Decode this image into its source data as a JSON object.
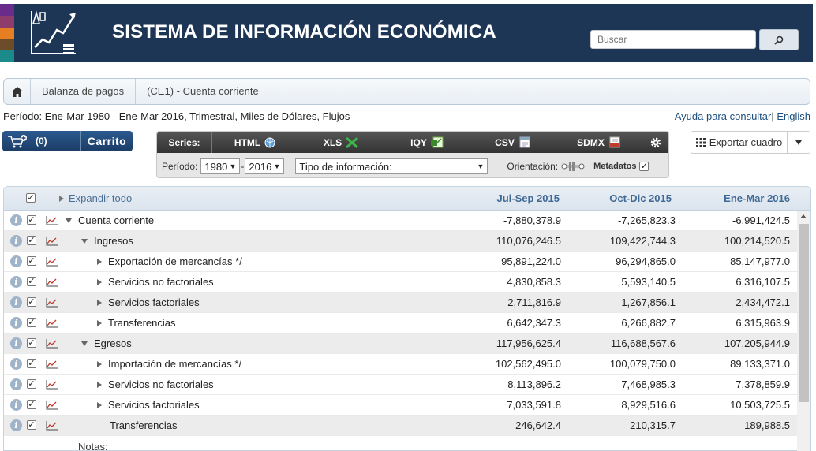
{
  "header": {
    "title": "SISTEMA DE INFORMACIÓN ECONÓMICA",
    "search_placeholder": "Buscar",
    "stripe_colors": [
      "#6a2c8a",
      "#c0392b",
      "#e67e22",
      "#6d4c2a",
      "#1b8a8a"
    ]
  },
  "breadcrumb": {
    "items": [
      "Balanza de pagos",
      "(CE1) - Cuenta corriente"
    ]
  },
  "period": {
    "label": "Período:",
    "text": "Ene-Mar 1980 - Ene-Mar 2016, Trimestral, Miles de Dólares, Flujos"
  },
  "help": {
    "ayuda": "Ayuda para consultar",
    "sep": "|",
    "english": " English"
  },
  "cart": {
    "count": "(0)",
    "label": "Carrito"
  },
  "toolbar": {
    "series_label": "Series:",
    "formats": [
      "HTML",
      "XLS",
      "IQY",
      "CSV",
      "SDMX"
    ],
    "periodo_label": "Período:",
    "from_year": "1980",
    "to_year": "2016",
    "year_sep": "-",
    "tipo_info": "Tipo de información:",
    "orientacion": "Orientación:",
    "metadatos": "Metadatos"
  },
  "export": {
    "label": "Exportar cuadro"
  },
  "table": {
    "expand_all": "Expandir todo",
    "columns": [
      "Jul-Sep 2015",
      "Oct-Dic 2015",
      "Ene-Mar 2016"
    ],
    "rows": [
      {
        "label": "Cuenta corriente",
        "values": [
          "-7,880,378.9",
          "-7,265,823.3",
          "-6,991,424.5"
        ]
      },
      {
        "label": "Ingresos",
        "values": [
          "110,076,246.5",
          "109,422,744.3",
          "100,214,520.5"
        ]
      },
      {
        "label": "Exportación de mercancías */",
        "values": [
          "95,891,224.0",
          "96,294,865.0",
          "85,147,977.0"
        ]
      },
      {
        "label": "Servicios no factoriales",
        "values": [
          "4,830,858.3",
          "5,593,140.5",
          "6,316,107.5"
        ]
      },
      {
        "label": "Servicios factoriales",
        "values": [
          "2,711,816.9",
          "1,267,856.1",
          "2,434,472.1"
        ]
      },
      {
        "label": "Transferencias",
        "values": [
          "6,642,347.3",
          "6,266,882.7",
          "6,315,963.9"
        ]
      },
      {
        "label": "Egresos",
        "values": [
          "117,956,625.4",
          "116,688,567.6",
          "107,205,944.9"
        ]
      },
      {
        "label": "Importación de mercancías */",
        "values": [
          "102,562,495.0",
          "100,079,750.0",
          "89,133,371.0"
        ]
      },
      {
        "label": "Servicios no factoriales",
        "values": [
          "8,113,896.2",
          "7,468,985.3",
          "7,378,859.9"
        ]
      },
      {
        "label": "Servicios factoriales",
        "values": [
          "7,033,591.8",
          "8,929,516.6",
          "10,503,725.5"
        ]
      },
      {
        "label": "Transferencias",
        "values": [
          "246,642.4",
          "210,315.7",
          "189,988.5"
        ]
      }
    ],
    "notes": "Notas:"
  }
}
